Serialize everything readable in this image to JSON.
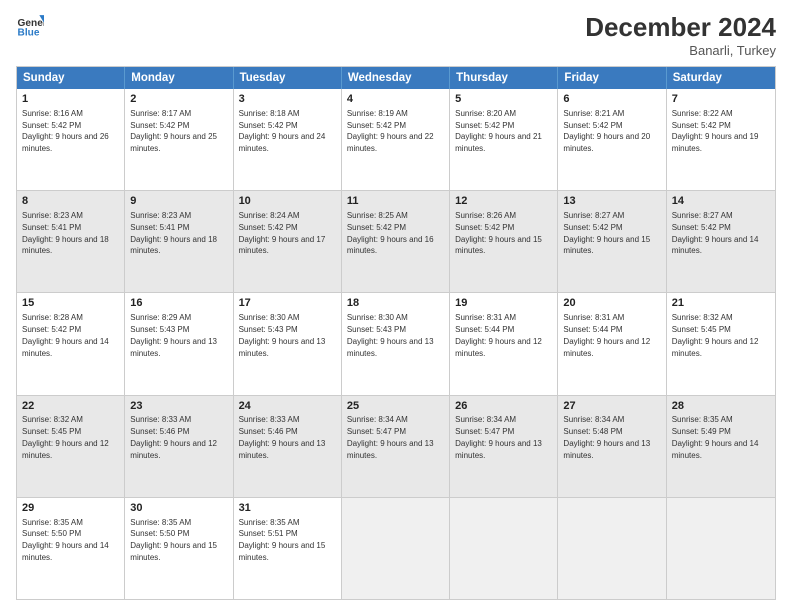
{
  "header": {
    "logo_line1": "General",
    "logo_line2": "Blue",
    "main_title": "December 2024",
    "subtitle": "Banarli, Turkey"
  },
  "days": [
    "Sunday",
    "Monday",
    "Tuesday",
    "Wednesday",
    "Thursday",
    "Friday",
    "Saturday"
  ],
  "weeks": [
    [
      {
        "day": "1",
        "sunrise": "8:16 AM",
        "sunset": "5:42 PM",
        "daylight": "9 hours and 26 minutes.",
        "shade": false
      },
      {
        "day": "2",
        "sunrise": "8:17 AM",
        "sunset": "5:42 PM",
        "daylight": "9 hours and 25 minutes.",
        "shade": false
      },
      {
        "day": "3",
        "sunrise": "8:18 AM",
        "sunset": "5:42 PM",
        "daylight": "9 hours and 24 minutes.",
        "shade": false
      },
      {
        "day": "4",
        "sunrise": "8:19 AM",
        "sunset": "5:42 PM",
        "daylight": "9 hours and 22 minutes.",
        "shade": false
      },
      {
        "day": "5",
        "sunrise": "8:20 AM",
        "sunset": "5:42 PM",
        "daylight": "9 hours and 21 minutes.",
        "shade": false
      },
      {
        "day": "6",
        "sunrise": "8:21 AM",
        "sunset": "5:42 PM",
        "daylight": "9 hours and 20 minutes.",
        "shade": false
      },
      {
        "day": "7",
        "sunrise": "8:22 AM",
        "sunset": "5:42 PM",
        "daylight": "9 hours and 19 minutes.",
        "shade": false
      }
    ],
    [
      {
        "day": "8",
        "sunrise": "8:23 AM",
        "sunset": "5:41 PM",
        "daylight": "9 hours and 18 minutes.",
        "shade": true
      },
      {
        "day": "9",
        "sunrise": "8:23 AM",
        "sunset": "5:41 PM",
        "daylight": "9 hours and 18 minutes.",
        "shade": true
      },
      {
        "day": "10",
        "sunrise": "8:24 AM",
        "sunset": "5:42 PM",
        "daylight": "9 hours and 17 minutes.",
        "shade": true
      },
      {
        "day": "11",
        "sunrise": "8:25 AM",
        "sunset": "5:42 PM",
        "daylight": "9 hours and 16 minutes.",
        "shade": true
      },
      {
        "day": "12",
        "sunrise": "8:26 AM",
        "sunset": "5:42 PM",
        "daylight": "9 hours and 15 minutes.",
        "shade": true
      },
      {
        "day": "13",
        "sunrise": "8:27 AM",
        "sunset": "5:42 PM",
        "daylight": "9 hours and 15 minutes.",
        "shade": true
      },
      {
        "day": "14",
        "sunrise": "8:27 AM",
        "sunset": "5:42 PM",
        "daylight": "9 hours and 14 minutes.",
        "shade": true
      }
    ],
    [
      {
        "day": "15",
        "sunrise": "8:28 AM",
        "sunset": "5:42 PM",
        "daylight": "9 hours and 14 minutes.",
        "shade": false
      },
      {
        "day": "16",
        "sunrise": "8:29 AM",
        "sunset": "5:43 PM",
        "daylight": "9 hours and 13 minutes.",
        "shade": false
      },
      {
        "day": "17",
        "sunrise": "8:30 AM",
        "sunset": "5:43 PM",
        "daylight": "9 hours and 13 minutes.",
        "shade": false
      },
      {
        "day": "18",
        "sunrise": "8:30 AM",
        "sunset": "5:43 PM",
        "daylight": "9 hours and 13 minutes.",
        "shade": false
      },
      {
        "day": "19",
        "sunrise": "8:31 AM",
        "sunset": "5:44 PM",
        "daylight": "9 hours and 12 minutes.",
        "shade": false
      },
      {
        "day": "20",
        "sunrise": "8:31 AM",
        "sunset": "5:44 PM",
        "daylight": "9 hours and 12 minutes.",
        "shade": false
      },
      {
        "day": "21",
        "sunrise": "8:32 AM",
        "sunset": "5:45 PM",
        "daylight": "9 hours and 12 minutes.",
        "shade": false
      }
    ],
    [
      {
        "day": "22",
        "sunrise": "8:32 AM",
        "sunset": "5:45 PM",
        "daylight": "9 hours and 12 minutes.",
        "shade": true
      },
      {
        "day": "23",
        "sunrise": "8:33 AM",
        "sunset": "5:46 PM",
        "daylight": "9 hours and 12 minutes.",
        "shade": true
      },
      {
        "day": "24",
        "sunrise": "8:33 AM",
        "sunset": "5:46 PM",
        "daylight": "9 hours and 13 minutes.",
        "shade": true
      },
      {
        "day": "25",
        "sunrise": "8:34 AM",
        "sunset": "5:47 PM",
        "daylight": "9 hours and 13 minutes.",
        "shade": true
      },
      {
        "day": "26",
        "sunrise": "8:34 AM",
        "sunset": "5:47 PM",
        "daylight": "9 hours and 13 minutes.",
        "shade": true
      },
      {
        "day": "27",
        "sunrise": "8:34 AM",
        "sunset": "5:48 PM",
        "daylight": "9 hours and 13 minutes.",
        "shade": true
      },
      {
        "day": "28",
        "sunrise": "8:35 AM",
        "sunset": "5:49 PM",
        "daylight": "9 hours and 14 minutes.",
        "shade": true
      }
    ],
    [
      {
        "day": "29",
        "sunrise": "8:35 AM",
        "sunset": "5:50 PM",
        "daylight": "9 hours and 14 minutes.",
        "shade": false
      },
      {
        "day": "30",
        "sunrise": "8:35 AM",
        "sunset": "5:50 PM",
        "daylight": "9 hours and 15 minutes.",
        "shade": false
      },
      {
        "day": "31",
        "sunrise": "8:35 AM",
        "sunset": "5:51 PM",
        "daylight": "9 hours and 15 minutes.",
        "shade": false
      },
      {
        "day": "",
        "sunrise": "",
        "sunset": "",
        "daylight": "",
        "shade": false,
        "empty": true
      },
      {
        "day": "",
        "sunrise": "",
        "sunset": "",
        "daylight": "",
        "shade": false,
        "empty": true
      },
      {
        "day": "",
        "sunrise": "",
        "sunset": "",
        "daylight": "",
        "shade": false,
        "empty": true
      },
      {
        "day": "",
        "sunrise": "",
        "sunset": "",
        "daylight": "",
        "shade": false,
        "empty": true
      }
    ]
  ],
  "labels": {
    "sunrise": "Sunrise:",
    "sunset": "Sunset:",
    "daylight": "Daylight:"
  }
}
